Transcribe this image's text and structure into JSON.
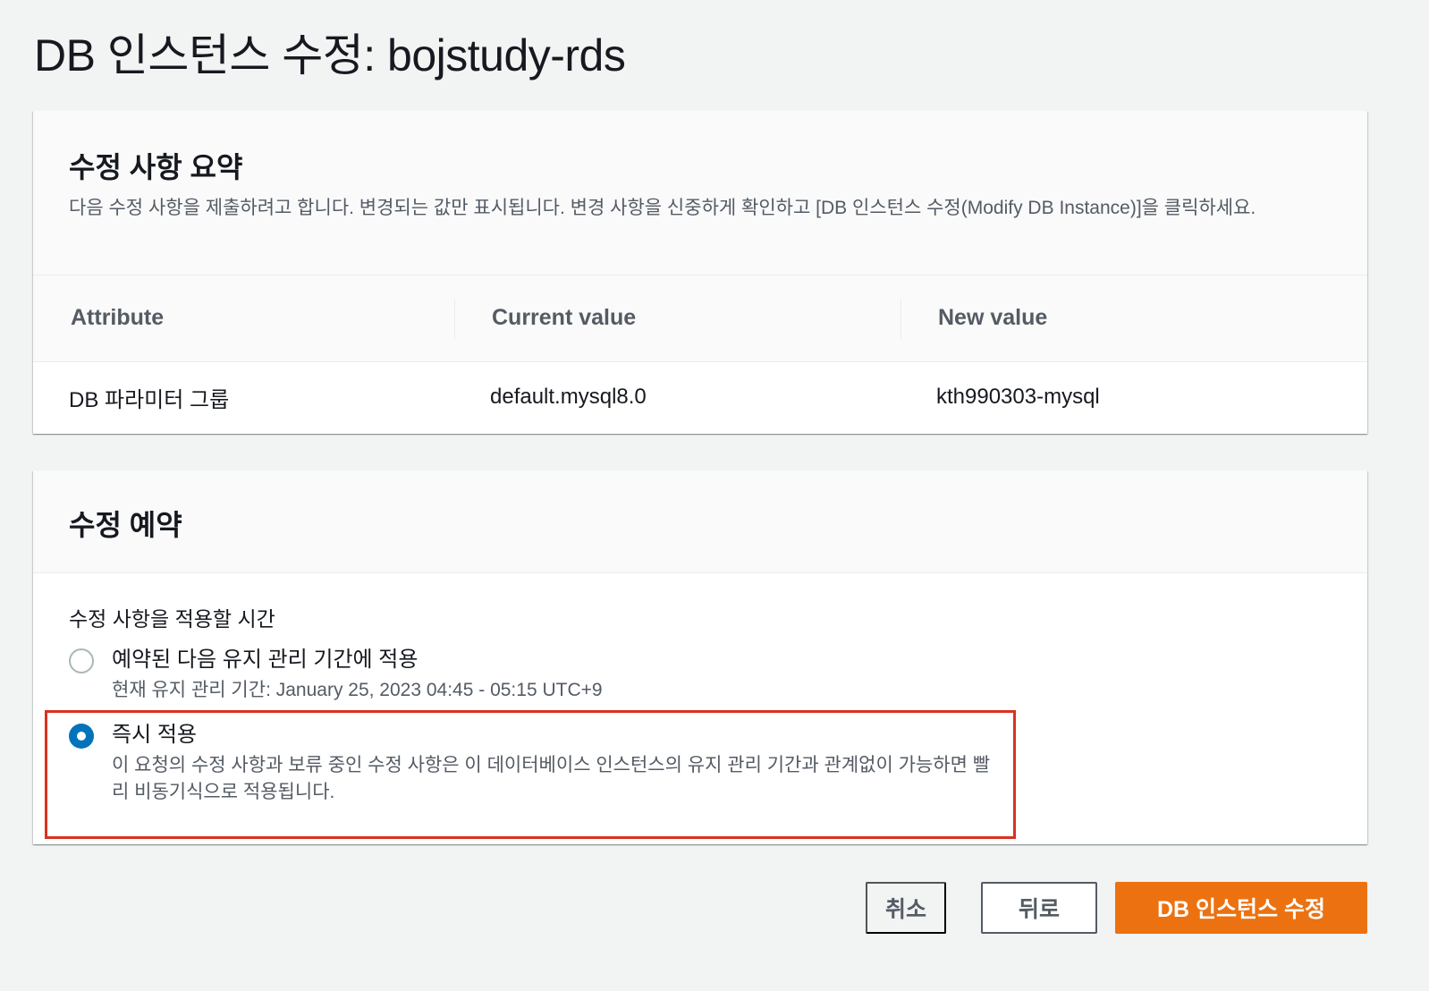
{
  "page": {
    "title": "DB 인스턴스 수정: bojstudy-rds"
  },
  "summary": {
    "heading": "수정 사항 요약",
    "description": "다음 수정 사항을 제출하려고 합니다. 변경되는 값만 표시됩니다. 변경 사항을 신중하게 확인하고 [DB 인스턴스 수정(Modify DB Instance)]을 클릭하세요.",
    "columns": [
      "Attribute",
      "Current value",
      "New value"
    ],
    "rows": [
      {
        "attribute": "DB 파라미터 그룹",
        "current": "default.mysql8.0",
        "new": "kth990303-mysql"
      }
    ]
  },
  "schedule": {
    "heading": "수정 예약",
    "field_label": "수정 사항을 적용할 시간",
    "options": [
      {
        "label": "예약된 다음 유지 관리 기간에 적용",
        "description": "현재 유지 관리 기간: January 25, 2023 04:45 - 05:15 UTC+9",
        "selected": false
      },
      {
        "label": "즉시 적용",
        "description": "이 요청의 수정 사항과 보류 중인 수정 사항은 이 데이터베이스 인스턴스의 유지 관리 기간과 관계없이 가능하면 빨리 비동기식으로 적용됩니다.",
        "selected": true
      }
    ]
  },
  "actions": {
    "cancel_label": "취소",
    "back_label": "뒤로",
    "submit_label": "DB 인스턴스 수정"
  },
  "colors": {
    "primary_button": "#ec7211",
    "radio_selected": "#0073bb",
    "highlight_border": "#d9321f"
  }
}
